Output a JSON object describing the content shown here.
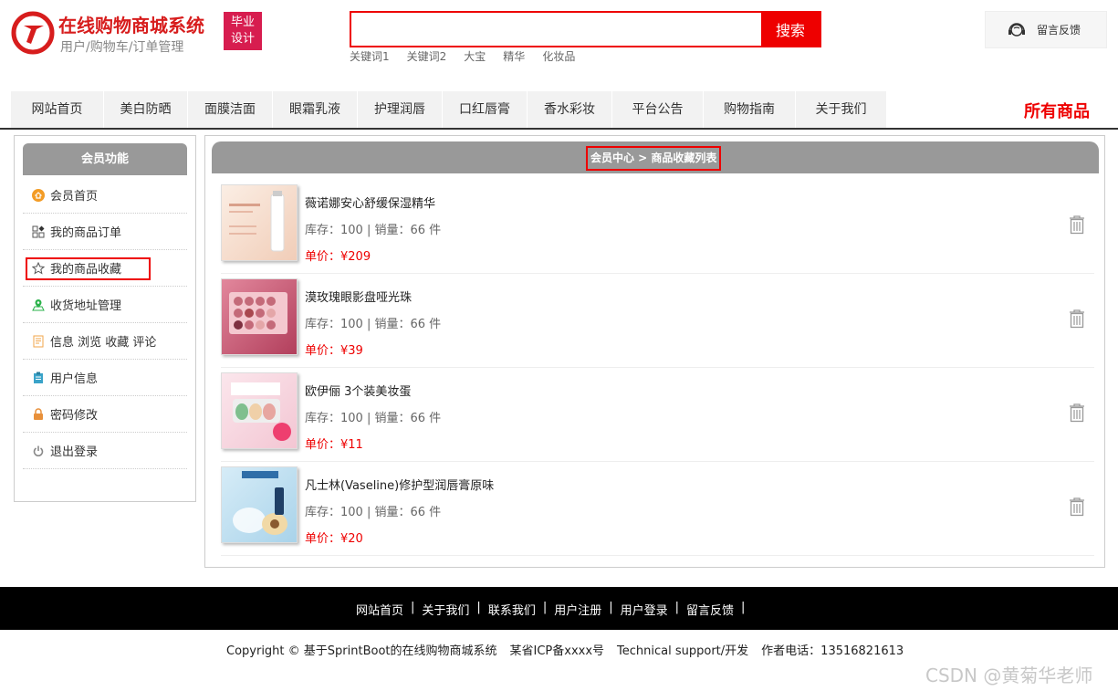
{
  "header": {
    "site_title": "在线购物商城系统",
    "site_subtitle": "用户/购物车/订单管理",
    "badge_line1": "毕业",
    "badge_line2": "设计",
    "search": {
      "placeholder": "",
      "button_label": "搜索"
    },
    "keywords": [
      "关键词1",
      "关键词2",
      "大宝",
      "精华",
      "化妆品"
    ],
    "feedback_label": "留言反馈"
  },
  "nav": {
    "items": [
      "网站首页",
      "美白防晒",
      "面膜洁面",
      "眼霜乳液",
      "护理润唇",
      "口红唇膏",
      "香水彩妆",
      "平台公告",
      "购物指南",
      "关于我们"
    ],
    "all_products": "所有商品"
  },
  "sidebar": {
    "title": "会员功能",
    "items": [
      {
        "label": "会员首页",
        "icon": "home-icon",
        "color": "#f39c26"
      },
      {
        "label": "我的商品订单",
        "icon": "orders-grid-icon",
        "color": "#555"
      },
      {
        "label": "我的商品收藏",
        "icon": "star-icon",
        "color": "#555"
      },
      {
        "label": "收货地址管理",
        "icon": "map-pin-icon",
        "color": "#2ab24a"
      },
      {
        "label": "信息 浏览 收藏 评论",
        "icon": "document-icon",
        "color": "#f2a54a"
      },
      {
        "label": "用户信息",
        "icon": "clipboard-icon",
        "color": "#3aa3c9"
      },
      {
        "label": "密码修改",
        "icon": "lock-icon",
        "color": "#e8903a"
      },
      {
        "label": "退出登录",
        "icon": "power-icon",
        "color": "#888"
      }
    ]
  },
  "main": {
    "breadcrumb": "会员中心 > 商品收藏列表",
    "products": [
      {
        "name": "薇诺娜安心舒缓保湿精华",
        "stock": "库存：100 | 销量：66 件",
        "price": "单价：¥209",
        "thumb_color": "#f6d9c8"
      },
      {
        "name": "漠玫瑰眼影盘哑光珠",
        "stock": "库存：100 | 销量：66 件",
        "price": "单价：¥39",
        "thumb_color": "#c95070"
      },
      {
        "name": "欧伊俪 3个装美妆蛋",
        "stock": "库存：100 | 销量：66 件",
        "price": "单价：¥11",
        "thumb_color": "#f4d6df"
      },
      {
        "name": "凡士林(Vaseline)修护型润唇膏原味",
        "stock": "库存：100 | 销量：66 件",
        "price": "单价：¥20",
        "thumb_color": "#bfe0f0"
      }
    ]
  },
  "footer": {
    "links": [
      "网站首页",
      "关于我们",
      "联系我们",
      "用户注册",
      "用户登录",
      "留言反馈"
    ],
    "copyright": "Copyright © 基于SprintBoot的在线购物商城系统",
    "icp": "某省ICP备xxxx号",
    "support": "Technical support/开发",
    "phone": "作者电话：13516821613"
  },
  "watermark": "CSDN @黄菊华老师",
  "colors": {
    "accent": "#e00000",
    "header_gray": "#999999",
    "footer_bg": "#000000"
  }
}
